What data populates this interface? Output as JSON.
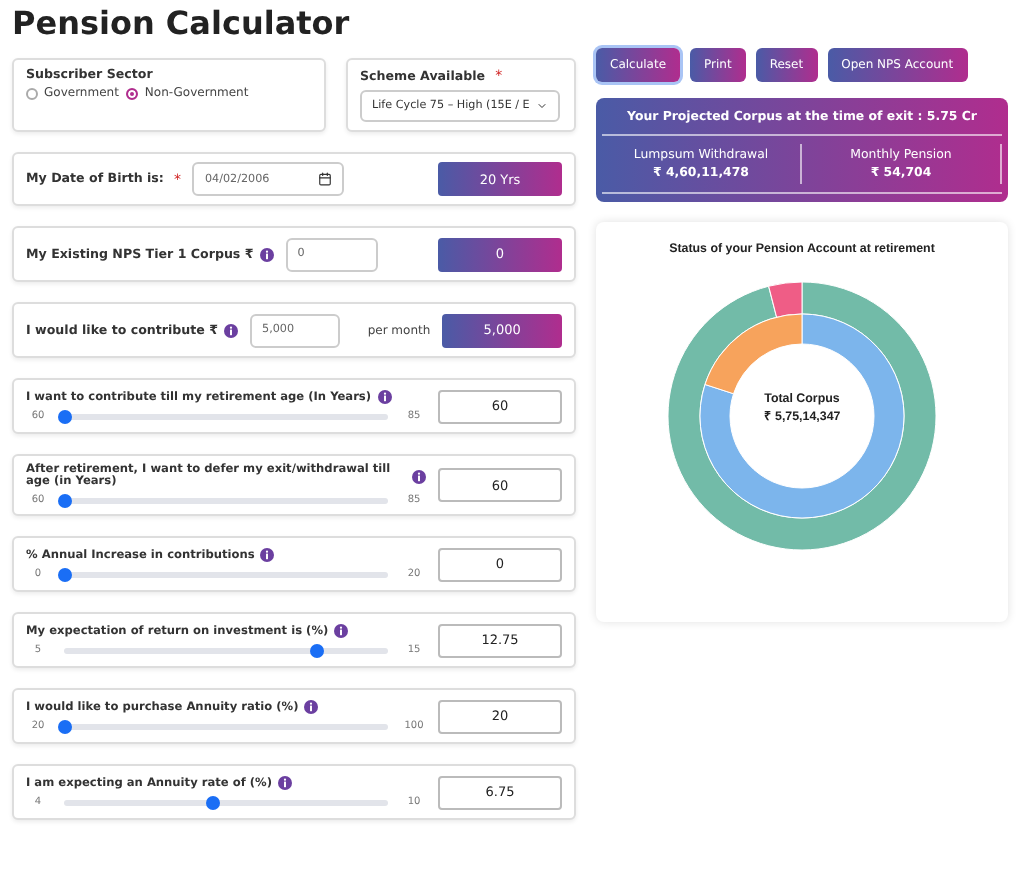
{
  "title": "Pension Calculator",
  "sector": {
    "label": "Subscriber Sector",
    "options": [
      {
        "label": "Government",
        "selected": false
      },
      {
        "label": "Non-Government",
        "selected": true
      }
    ]
  },
  "scheme": {
    "label": "Scheme Available",
    "required_mark": "*",
    "value": "Life Cycle 75 – High (15E / E"
  },
  "rows": [
    {
      "kind": "date",
      "label": "My Date of Birth is:",
      "required_mark": "*",
      "value": "04/02/2006",
      "result": "20 Yrs"
    },
    {
      "kind": "amount",
      "label": "My Existing NPS Tier 1 Corpus ₹",
      "info": true,
      "value": "0",
      "result": "0"
    },
    {
      "kind": "amount",
      "label": "I would like to contribute ₹",
      "info": true,
      "value": "5,000",
      "suffix": "per month",
      "result": "5,000"
    },
    {
      "kind": "slider",
      "label": "I want to contribute till my retirement age (In Years)",
      "info": true,
      "min": "60",
      "max": "85",
      "level": 0,
      "value": "60"
    },
    {
      "kind": "slider",
      "label": "After retirement, I want to defer my exit/withdrawal till age (in Years)",
      "info": true,
      "min": "60",
      "max": "85",
      "level": 0,
      "value": "60"
    },
    {
      "kind": "slider",
      "label": "% Annual Increase in contributions",
      "info": true,
      "min": "0",
      "max": "20",
      "level": 0,
      "value": "0"
    },
    {
      "kind": "slider",
      "label": "My expectation of return on investment is (%)",
      "info": true,
      "min": "5",
      "max": "15",
      "level": 0.775,
      "value": "12.75"
    },
    {
      "kind": "slider",
      "label": "I would like to purchase Annuity ratio (%)",
      "info": true,
      "min": "20",
      "max": "100",
      "level": 0,
      "value": "20"
    },
    {
      "kind": "slider",
      "label": "I am expecting an Annuity rate of (%)",
      "info": true,
      "min": "4",
      "max": "10",
      "level": 0.458,
      "value": "6.75"
    }
  ],
  "actions": [
    {
      "label": "Calculate",
      "selected": true
    },
    {
      "label": "Print",
      "selected": false
    },
    {
      "label": "Reset",
      "selected": false
    },
    {
      "label": "Open NPS Account",
      "selected": false
    }
  ],
  "result": {
    "headline": "Your Projected Corpus at the time of exit : 5.75 Cr",
    "items": [
      {
        "label": "Lumpsum Withdrawal",
        "value": "₹ 4,60,11,478"
      },
      {
        "label": "Monthly Pension",
        "value": "₹ 54,704"
      }
    ]
  },
  "chart": {
    "title": "Status of your Pension Account at retirement",
    "center_label": "Total Corpus",
    "center_value": "₹ 5,75,14,347"
  }
}
